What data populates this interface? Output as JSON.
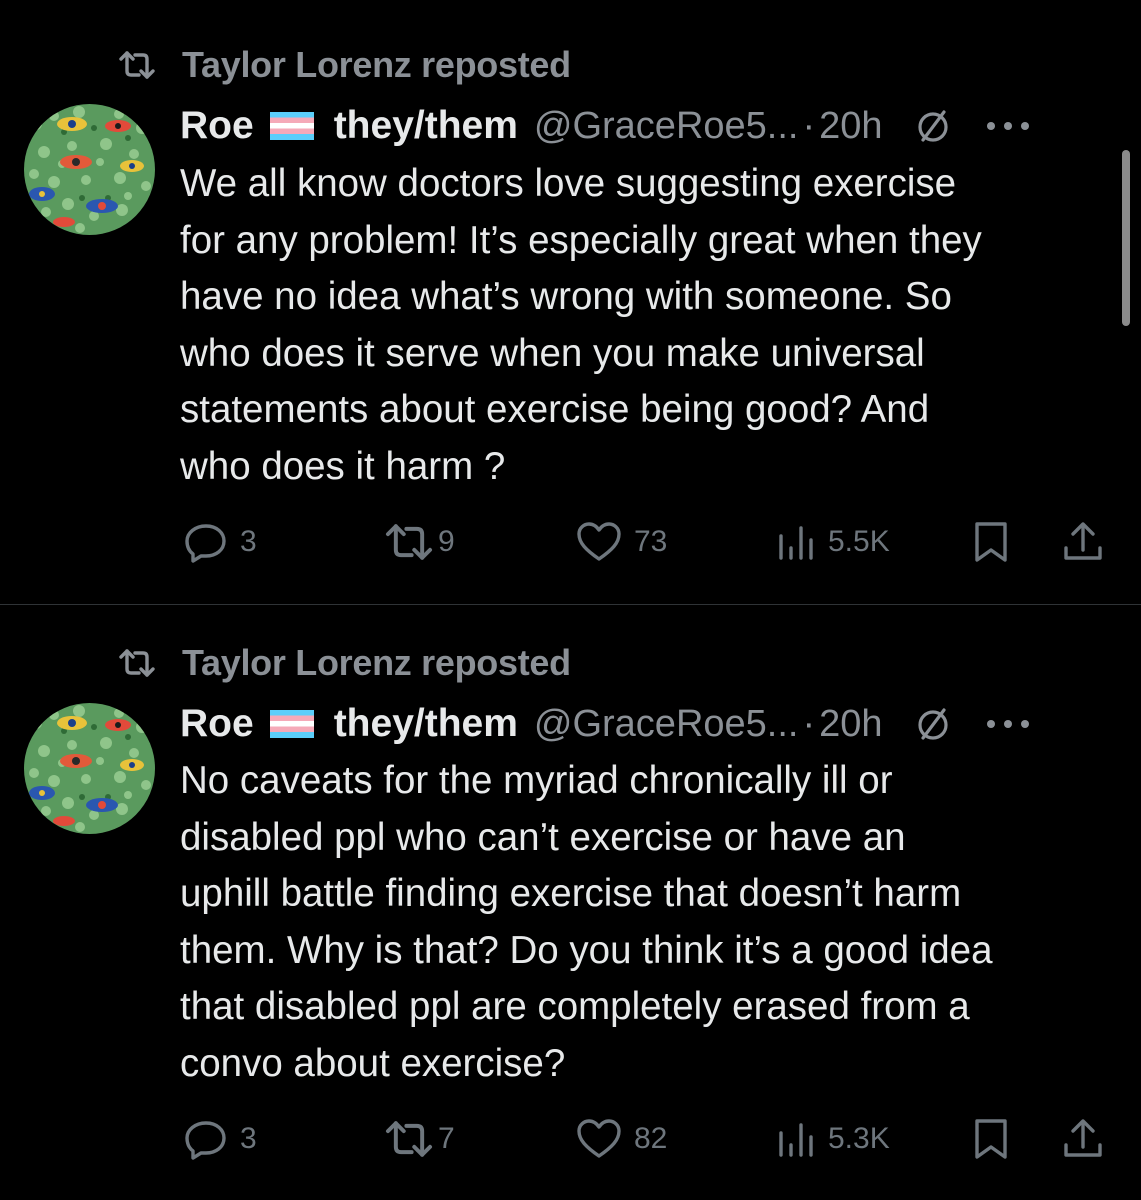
{
  "posts": [
    {
      "repost_label": "Taylor Lorenz reposted",
      "author_name": "Roe",
      "pronouns": "they/them",
      "handle": "@GraceRoe5...",
      "separator": "·",
      "time": "20h",
      "lines": [
        "We all know doctors love suggesting exercise",
        "for any problem! It’s especially great when they",
        "have no idea what’s wrong with someone. So",
        "who does it serve when you make universal",
        "statements about exercise being good? And",
        "who does it harm ?"
      ],
      "replies": "3",
      "reposts": "9",
      "likes": "73",
      "views": "5.5K"
    },
    {
      "repost_label": "Taylor Lorenz reposted",
      "author_name": "Roe",
      "pronouns": "they/them",
      "handle": "@GraceRoe5...",
      "separator": "·",
      "time": "20h",
      "lines": [
        "No caveats for the myriad chronically ill or",
        "disabled ppl who can’t exercise or have an",
        "uphill battle finding exercise that doesn’t harm",
        "them. Why is that? Do you think it’s a good idea",
        "that disabled ppl are completely erased from a",
        "convo about exercise?"
      ],
      "replies": "3",
      "reposts": "7",
      "likes": "82",
      "views": "5.3K"
    }
  ],
  "icons": {
    "repost": "repost-icon",
    "flag": "transgender-flag-icon",
    "no_access": "no-symbol-icon",
    "more": "more-dots-icon",
    "reply": "reply-bubble-icon",
    "like": "heart-icon",
    "views": "views-bar-chart-icon",
    "bookmark": "bookmark-icon",
    "share": "share-icon"
  },
  "colors": {
    "background": "#000000",
    "primary_text": "#e7e9ea",
    "secondary_text": "#8b9096",
    "flag_blue": "#5bcefa",
    "flag_pink": "#f5a9b8",
    "avatar_green": "#5a9a5e"
  }
}
